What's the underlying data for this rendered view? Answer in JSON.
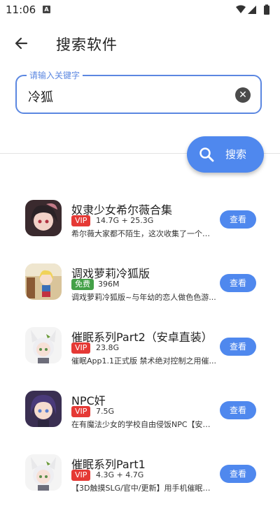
{
  "status_bar": {
    "time": "11:06",
    "notification_icon": "A"
  },
  "header": {
    "title": "搜索软件"
  },
  "search": {
    "label": "请输入关键字",
    "value": "冷狐"
  },
  "search_button": {
    "label": "搜索"
  },
  "apps": [
    {
      "title": "奴隶少女希尔薇合集",
      "badge": "VIP",
      "badge_color": "#e53935",
      "size": "14.7G + 25.3G",
      "description": "希尔薇大家都不陌生，这次收集了一个小...",
      "button": "查看",
      "icon": "anime-girl-dark-icon"
    },
    {
      "title": "调戏萝莉冷狐版",
      "badge": "免费",
      "badge_color": "#43a047",
      "size": "396M",
      "description": "调戏萝莉冷狐版~与年幼的恋人做色色游...",
      "button": "查看",
      "icon": "anime-girl-room-icon"
    },
    {
      "title": "催眠系列Part2（安卓直装）",
      "badge": "VIP",
      "badge_color": "#e53935",
      "size": "23.8G",
      "description": "催眠App1.1正式版 禁术绝对控制之用催...",
      "button": "查看",
      "icon": "catgirl-icon"
    },
    {
      "title": "NPC奸",
      "badge": "VIP",
      "badge_color": "#e53935",
      "size": "7.5G",
      "description": "在有魔法少女的学校自由侵饭NPC【安卓...",
      "button": "查看",
      "icon": "anime-girl-purple-hair-icon"
    },
    {
      "title": "催眠系列Part1",
      "badge": "VIP",
      "badge_color": "#e53935",
      "size": "4.3G + 4.7G",
      "description": "【3D触摸SLG/官中/更新】用手机催眠偶...",
      "button": "查看",
      "icon": "catgirl-icon"
    }
  ]
}
